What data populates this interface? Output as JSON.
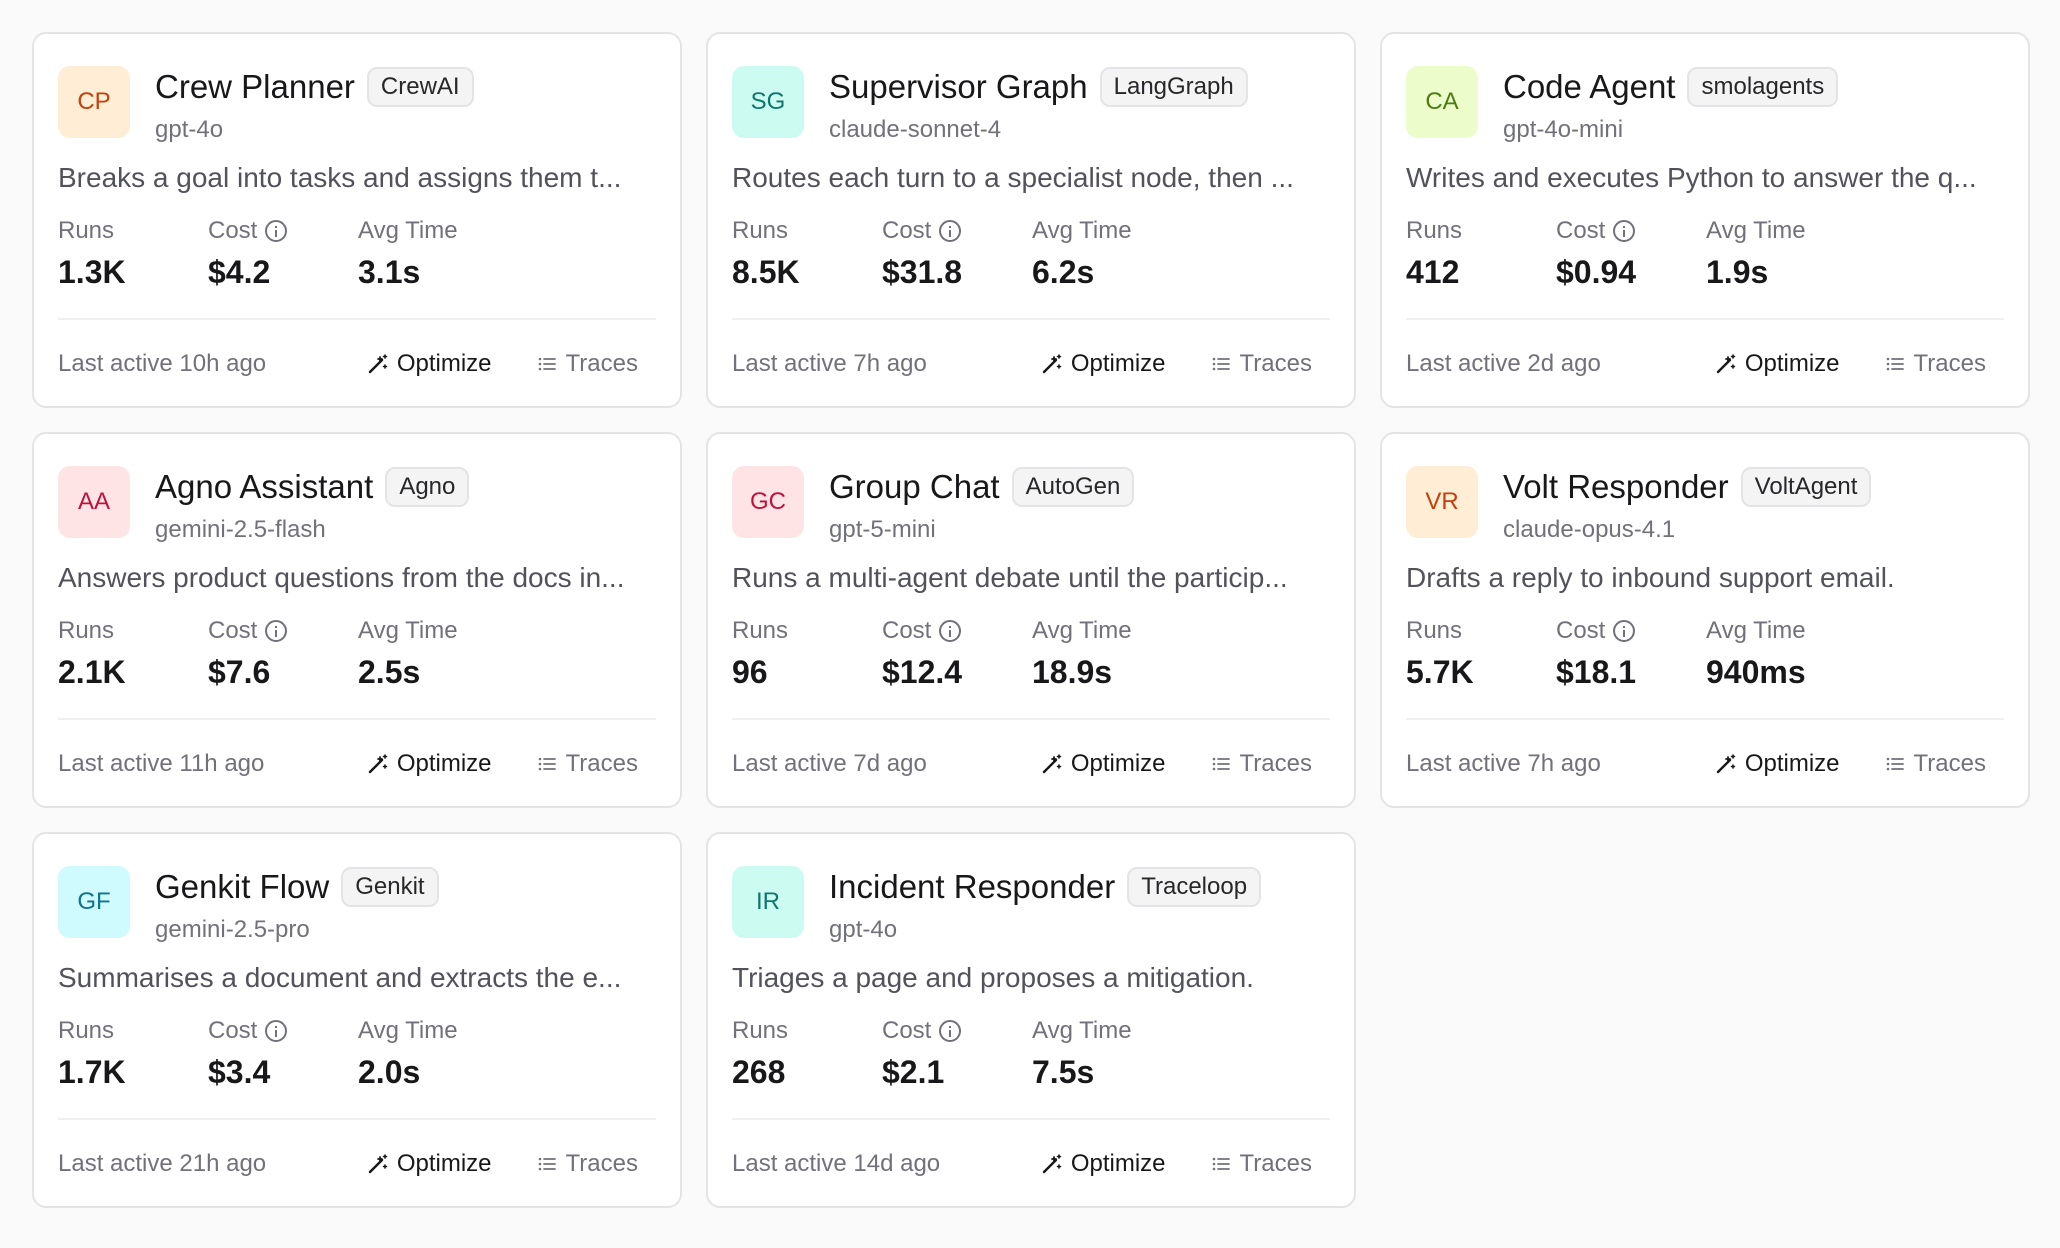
{
  "labels": {
    "runs": "Runs",
    "cost": "Cost",
    "avg_time": "Avg Time",
    "optimize": "Optimize",
    "traces": "Traces"
  },
  "icons": {
    "info": "info-icon",
    "optimize": "magic-wand-icon",
    "traces": "list-icon"
  },
  "agents": [
    {
      "initials": "CP",
      "name": "Crew Planner",
      "framework": "CrewAI",
      "model": "gpt-4o",
      "description": "Breaks a goal into tasks and assigns them t...",
      "runs": "1.3K",
      "cost": "$4.2",
      "avg_time": "3.1s",
      "last_active": "Last active 10h ago",
      "avatar_bg": "#ffedd5",
      "avatar_fg": "#c2410c"
    },
    {
      "initials": "SG",
      "name": "Supervisor Graph",
      "framework": "LangGraph",
      "model": "claude-sonnet-4",
      "description": "Routes each turn to a specialist node, then ...",
      "runs": "8.5K",
      "cost": "$31.8",
      "avg_time": "6.2s",
      "last_active": "Last active 7h ago",
      "avatar_bg": "#ccfbf1",
      "avatar_fg": "#0f766e"
    },
    {
      "initials": "CA",
      "name": "Code Agent",
      "framework": "smolagents",
      "model": "gpt-4o-mini",
      "description": "Writes and executes Python to answer the q...",
      "runs": "412",
      "cost": "$0.94",
      "avg_time": "1.9s",
      "last_active": "Last active 2d ago",
      "avatar_bg": "#ecfccb",
      "avatar_fg": "#4d7c0f"
    },
    {
      "initials": "AA",
      "name": "Agno Assistant",
      "framework": "Agno",
      "model": "gemini-2.5-flash",
      "description": "Answers product questions from the docs in...",
      "runs": "2.1K",
      "cost": "$7.6",
      "avg_time": "2.5s",
      "last_active": "Last active 11h ago",
      "avatar_bg": "#ffe4e6",
      "avatar_fg": "#be123c"
    },
    {
      "initials": "GC",
      "name": "Group Chat",
      "framework": "AutoGen",
      "model": "gpt-5-mini",
      "description": "Runs a multi-agent debate until the particip...",
      "runs": "96",
      "cost": "$12.4",
      "avg_time": "18.9s",
      "last_active": "Last active 7d ago",
      "avatar_bg": "#ffe4e6",
      "avatar_fg": "#be123c"
    },
    {
      "initials": "VR",
      "name": "Volt Responder",
      "framework": "VoltAgent",
      "model": "claude-opus-4.1",
      "description": "Drafts a reply to inbound support email.",
      "runs": "5.7K",
      "cost": "$18.1",
      "avg_time": "940ms",
      "last_active": "Last active 7h ago",
      "avatar_bg": "#ffedd5",
      "avatar_fg": "#c2410c"
    },
    {
      "initials": "GF",
      "name": "Genkit Flow",
      "framework": "Genkit",
      "model": "gemini-2.5-pro",
      "description": "Summarises a document and extracts the e...",
      "runs": "1.7K",
      "cost": "$3.4",
      "avg_time": "2.0s",
      "last_active": "Last active 21h ago",
      "avatar_bg": "#cffafe",
      "avatar_fg": "#0e7490"
    },
    {
      "initials": "IR",
      "name": "Incident Responder",
      "framework": "Traceloop",
      "model": "gpt-4o",
      "description": "Triages a page and proposes a mitigation.",
      "runs": "268",
      "cost": "$2.1",
      "avg_time": "7.5s",
      "last_active": "Last active 14d ago",
      "avatar_bg": "#ccfbf1",
      "avatar_fg": "#0f766e"
    }
  ]
}
